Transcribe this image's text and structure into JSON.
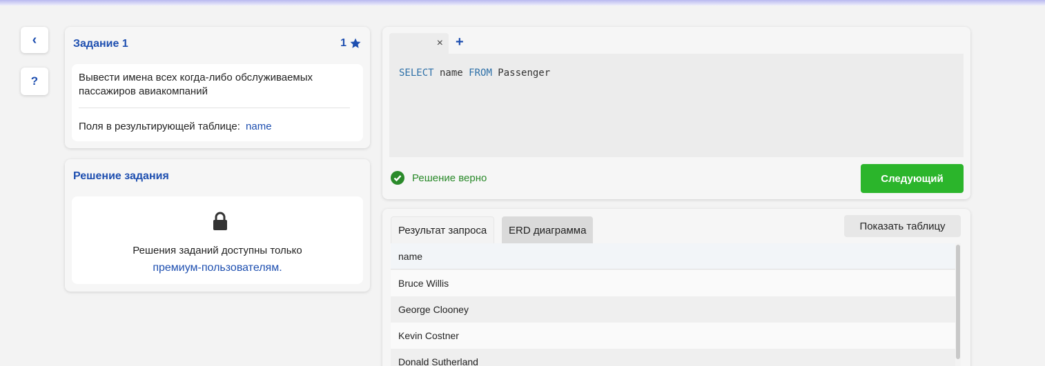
{
  "task": {
    "title": "Задание 1",
    "score": "1",
    "description": "Вывести имена всех когда-либо обслуживаемых пассажиров авиакомпаний",
    "fields_label": "Поля в результирующей таблице:",
    "fields_value": "name"
  },
  "solution": {
    "title": "Решение задания",
    "locked_text": "Решения заданий доступны только",
    "locked_link": "премиум-пользователям",
    "locked_suffix": "."
  },
  "side": {
    "back_label": "‹",
    "help_label": "?"
  },
  "editor": {
    "close_tab": "×",
    "add_tab": "+",
    "kw_select": "SELECT",
    "col": " name ",
    "kw_from": "FROM",
    "table": " Passenger",
    "status": "Решение верно",
    "next_button": "Следующий"
  },
  "results": {
    "tab_result": "Результат запроса",
    "tab_erd": "ERD диаграмма",
    "show_table_button": "Показать таблицу",
    "column": "name",
    "rows": [
      "Bruce Willis",
      "George Clooney",
      "Kevin Costner",
      "Donald Sutherland"
    ]
  },
  "colors": {
    "accent": "#1e4fb0",
    "success": "#2a8a2a",
    "button_green": "#2bb52b"
  }
}
